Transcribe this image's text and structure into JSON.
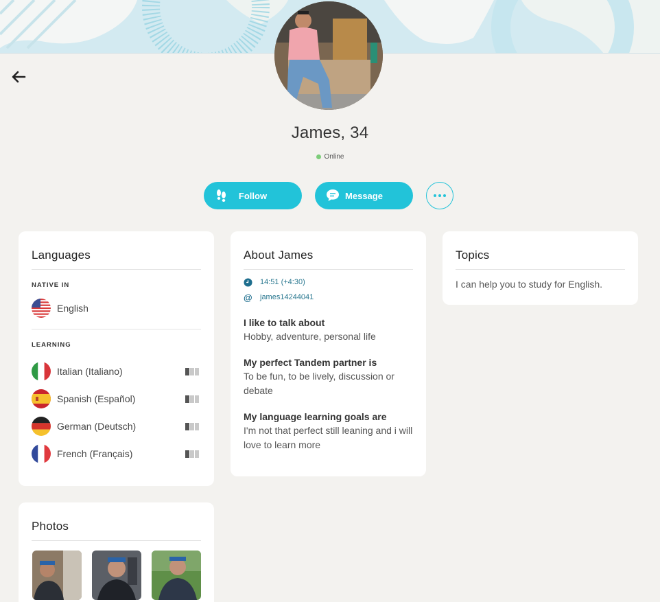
{
  "profile": {
    "name_age": "James, 34",
    "status": "Online"
  },
  "actions": {
    "follow": "Follow",
    "message": "Message"
  },
  "languages": {
    "title": "Languages",
    "native_label": "NATIVE IN",
    "native": [
      {
        "name": "English",
        "flag": "us-flag-icon"
      }
    ],
    "learning_label": "LEARNING",
    "learning": [
      {
        "name": "Italian (Italiano)",
        "flag": "italy-flag-icon",
        "level": 1
      },
      {
        "name": "Spanish (Español)",
        "flag": "spain-flag-icon",
        "level": 1
      },
      {
        "name": "German (Deutsch)",
        "flag": "germany-flag-icon",
        "level": 1
      },
      {
        "name": "French (Français)",
        "flag": "france-flag-icon",
        "level": 1
      }
    ],
    "level_max": 3
  },
  "about": {
    "title": "About James",
    "time": "14:51 (+4:30)",
    "username": "james14244041",
    "sections": [
      {
        "question": "I like to talk about",
        "answer": "Hobby, adventure, personal life"
      },
      {
        "question": "My perfect Tandem partner is",
        "answer": "To be fun, to be lively, discussion or debate"
      },
      {
        "question": "My language learning goals are",
        "answer": "I'm not that perfect still leaning and i will love to learn more"
      }
    ]
  },
  "topics": {
    "title": "Topics",
    "text": "I can help you to study for English."
  },
  "photos": {
    "title": "Photos"
  },
  "colors": {
    "accent": "#22c3d9",
    "online": "#7dcd7a",
    "link": "#2a7890"
  }
}
